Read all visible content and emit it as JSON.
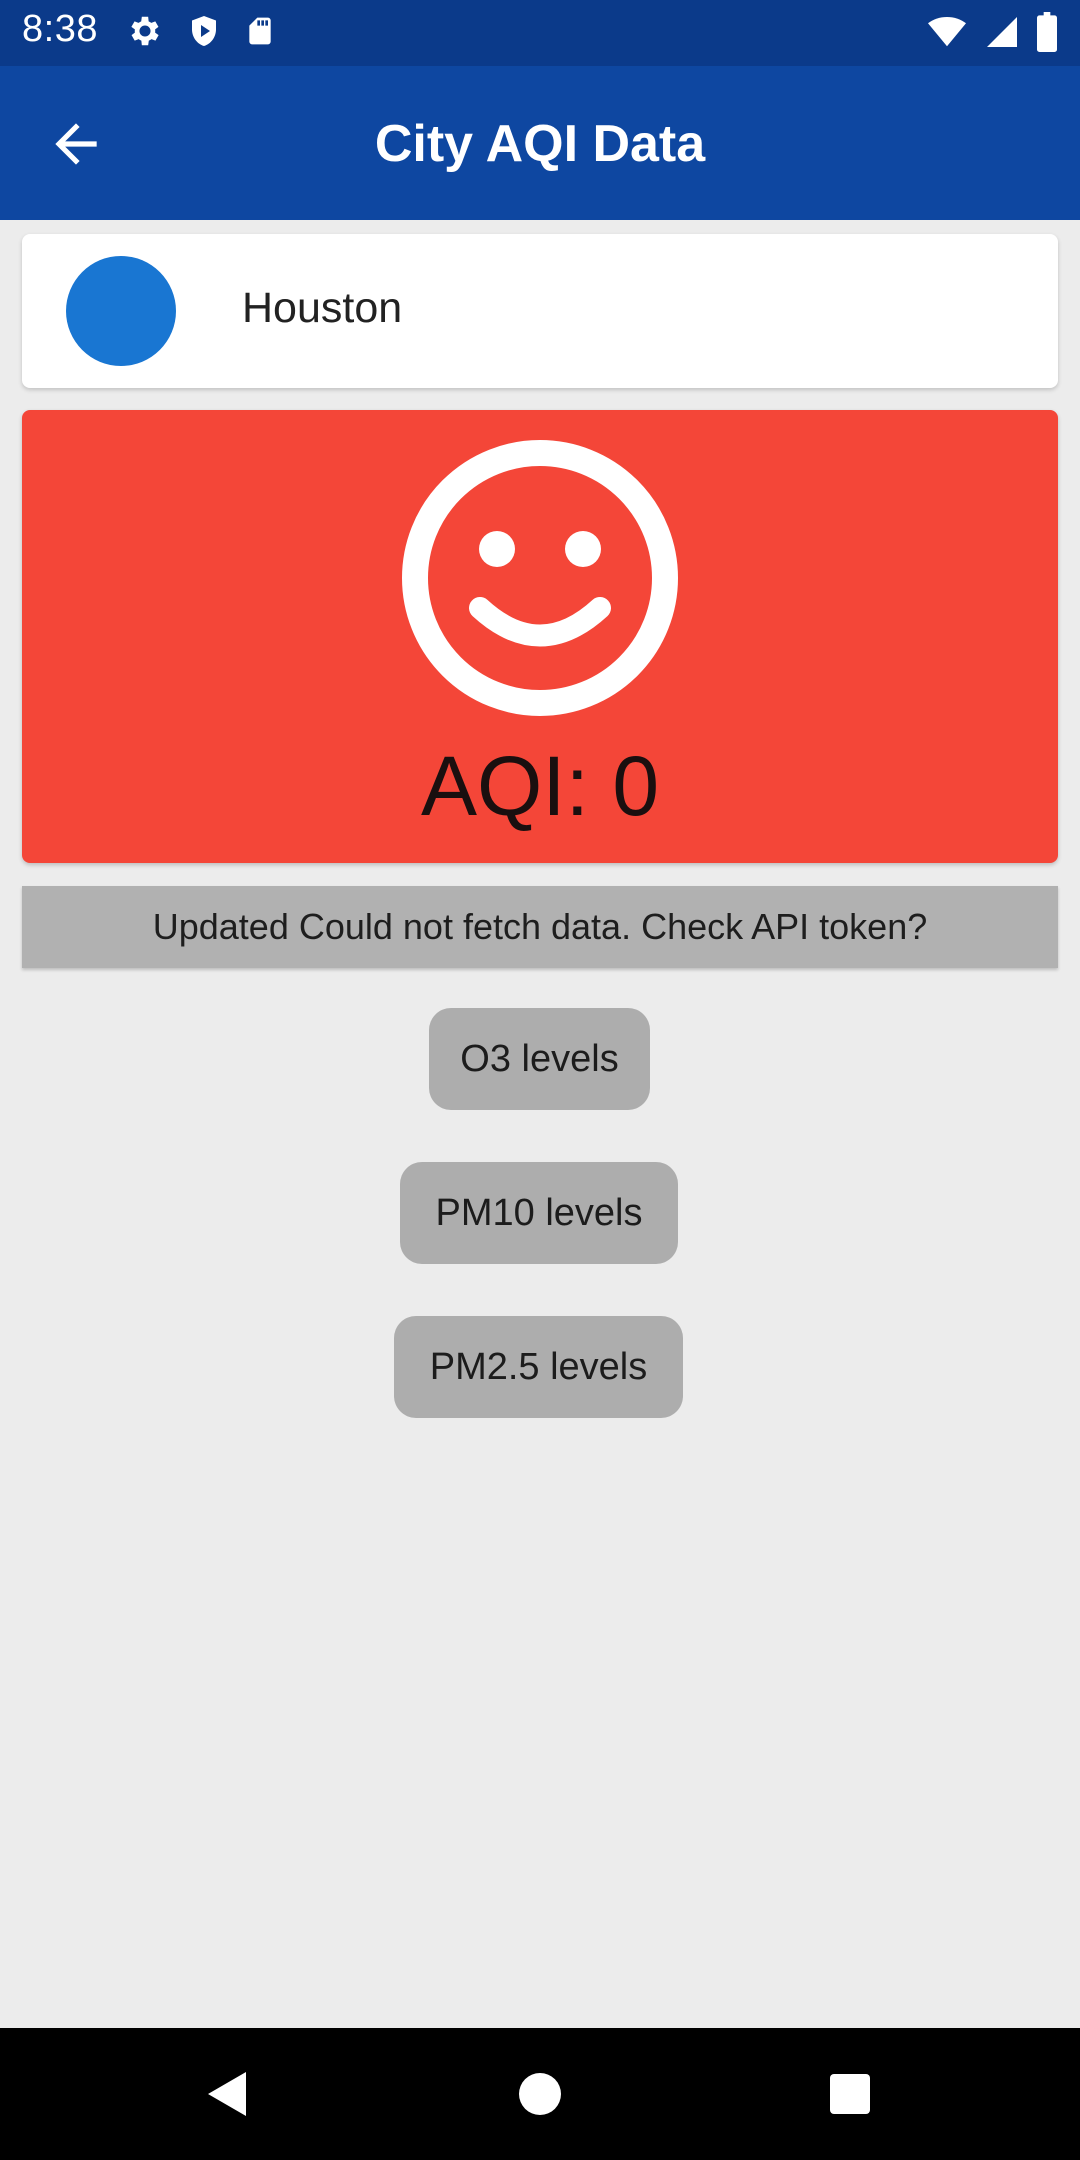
{
  "status_bar": {
    "time": "8:38",
    "left_icons": [
      "settings-icon",
      "shield-icon",
      "sd-card-icon"
    ],
    "right_icons": [
      "wifi-icon",
      "signal-icon",
      "battery-icon"
    ]
  },
  "app_bar": {
    "title": "City AQI Data",
    "back_icon": "arrow-back-icon",
    "background": "#0e47a1"
  },
  "city": {
    "name": "Houston",
    "dot_color": "#1976d2"
  },
  "aqi": {
    "label": "AQI: 0",
    "icon": "smiley-face-icon",
    "background": "#f44638"
  },
  "update_status": "Updated Could not fetch data. Check API token?",
  "buttons": {
    "o3": "O3 levels",
    "pm10": "PM10 levels",
    "pm25": "PM2.5 levels"
  },
  "nav_bar": {
    "items": [
      "back-icon",
      "home-icon",
      "recents-icon"
    ]
  }
}
